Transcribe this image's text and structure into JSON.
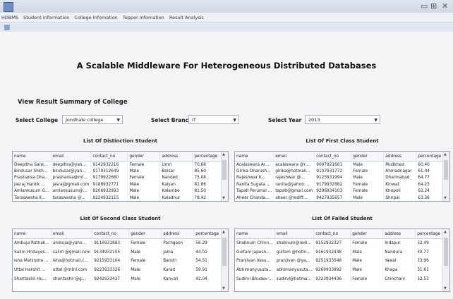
{
  "menu": [
    "HDBMS",
    "Student information",
    "College Infomation",
    "Topper Infomation",
    "Result Analysis"
  ],
  "window": {
    "min": "▭",
    "max": "⊞",
    "close": "✕"
  },
  "title": "A Scalable Middleware For Heterogeneous Distributed Databases",
  "summary_heading": "View Result Summary of College",
  "filters": {
    "college_label": "Select College",
    "college_value": "Jondhale college",
    "branch_label": "Select Branch",
    "branch_value": "IT",
    "year_label": "Select Year",
    "year_value": "2013"
  },
  "columns": [
    "name",
    "email",
    "contact_no",
    "gender",
    "address",
    "percentage"
  ],
  "distinction": {
    "caption": "List Of Distinction Student",
    "rows": [
      [
        "Deepitha Sank...",
        "deepitha@yah...",
        "9142932216",
        "Female",
        "Umri",
        "70.68"
      ],
      [
        "Bindusar Shkh...",
        "bindusar@yah...",
        "9179312649",
        "Male",
        "Boisar",
        "85.60"
      ],
      [
        "Prashansa Dha...",
        "prashansa@mt...",
        "9179922660",
        "Female",
        "Nanded",
        "75.08"
      ],
      [
        "Jasraj Hardik ...",
        "jasraj@gmail.com",
        "9188932771",
        "Male",
        "Kalyan",
        "81.86"
      ],
      [
        "Amlankusum G...",
        "amlankusum@...",
        "9206932993",
        "Male",
        "Kalambe",
        "81.50"
      ],
      [
        "Taraswesha K...",
        "taraswesha @...",
        "9224932115",
        "Male",
        "Kaladnur",
        "78.42"
      ]
    ]
  },
  "first_class": {
    "caption": "List Of First Class Student",
    "rows": [
      [
        "Acaleswara Ar...",
        "acaleswara @r...",
        "9097921661",
        "Male",
        "Mudkhed",
        "60.40"
      ],
      [
        "Girika Dharush...",
        "girika@hotmail...",
        "9107931772",
        "Female",
        "Ahmadnagar",
        "61.04"
      ],
      [
        "Rajeshwar K...",
        "rajeshwar @...",
        "9125931994",
        "Male",
        "Dharmabad",
        "64.77"
      ],
      [
        "Ranita Sugata ...",
        "ranita@yahoo....",
        "9179932882",
        "Female",
        "Kinwat",
        "64.23"
      ],
      [
        "Tapati Perumal ...",
        "tapati@gmail.com",
        "9296934103",
        "Female",
        "Khopoli",
        "63.24"
      ],
      [
        "Aheer Chanda...",
        "aheer @rediff...",
        "9427935657",
        "Male",
        "Shirpal",
        "63.36"
      ]
    ]
  },
  "second_class": {
    "caption": "List Of Second Class Student",
    "rows": [
      [
        "Ambuja Ratnak...",
        "ambuja@yaho...",
        "9116931883",
        "Female",
        "Pachgaon",
        "56.29"
      ],
      [
        "Salim Hridayes...",
        "salim @gmail.com",
        "9134932105",
        "Male",
        "Jalna",
        "44.01"
      ],
      [
        "Isha Mahindra ...",
        "isha@hotmail.c...",
        "9215933104",
        "Female",
        "Bandri",
        "54.51"
      ],
      [
        "Uttal Harshit ...",
        "uttal @mtnl.com",
        "9223933326",
        "Male",
        "Karad",
        "59.91"
      ],
      [
        "Shantashil Hu...",
        "shantashil @g...",
        "9242933437",
        "Male",
        "Kanvali",
        "42.04"
      ]
    ]
  },
  "failed": {
    "caption": "List Of Failed Student",
    "rows": [
      [
        "Shabnum Chinn...",
        "shabnum@redi...",
        "9152932327",
        "Female",
        "Indapur",
        "32.49"
      ],
      [
        "Gulfam Japesh...",
        "gulfam @hotm...",
        "9161932438",
        "Male",
        "Nandura",
        "30.77"
      ],
      [
        "Pranjivan Vasu...",
        "pranjivan @ya...",
        "9251933548",
        "Male",
        "Yawal",
        "33.96"
      ],
      [
        "Abhimanyusuta...",
        "abhimanyusuta...",
        "9269933992",
        "Male",
        "Khapa",
        "31.61"
      ],
      [
        "Sudirvi Bhudev ...",
        "sudirvi@hotma...",
        "9323934436",
        "Female",
        "Chinchani",
        "32.53"
      ]
    ]
  }
}
